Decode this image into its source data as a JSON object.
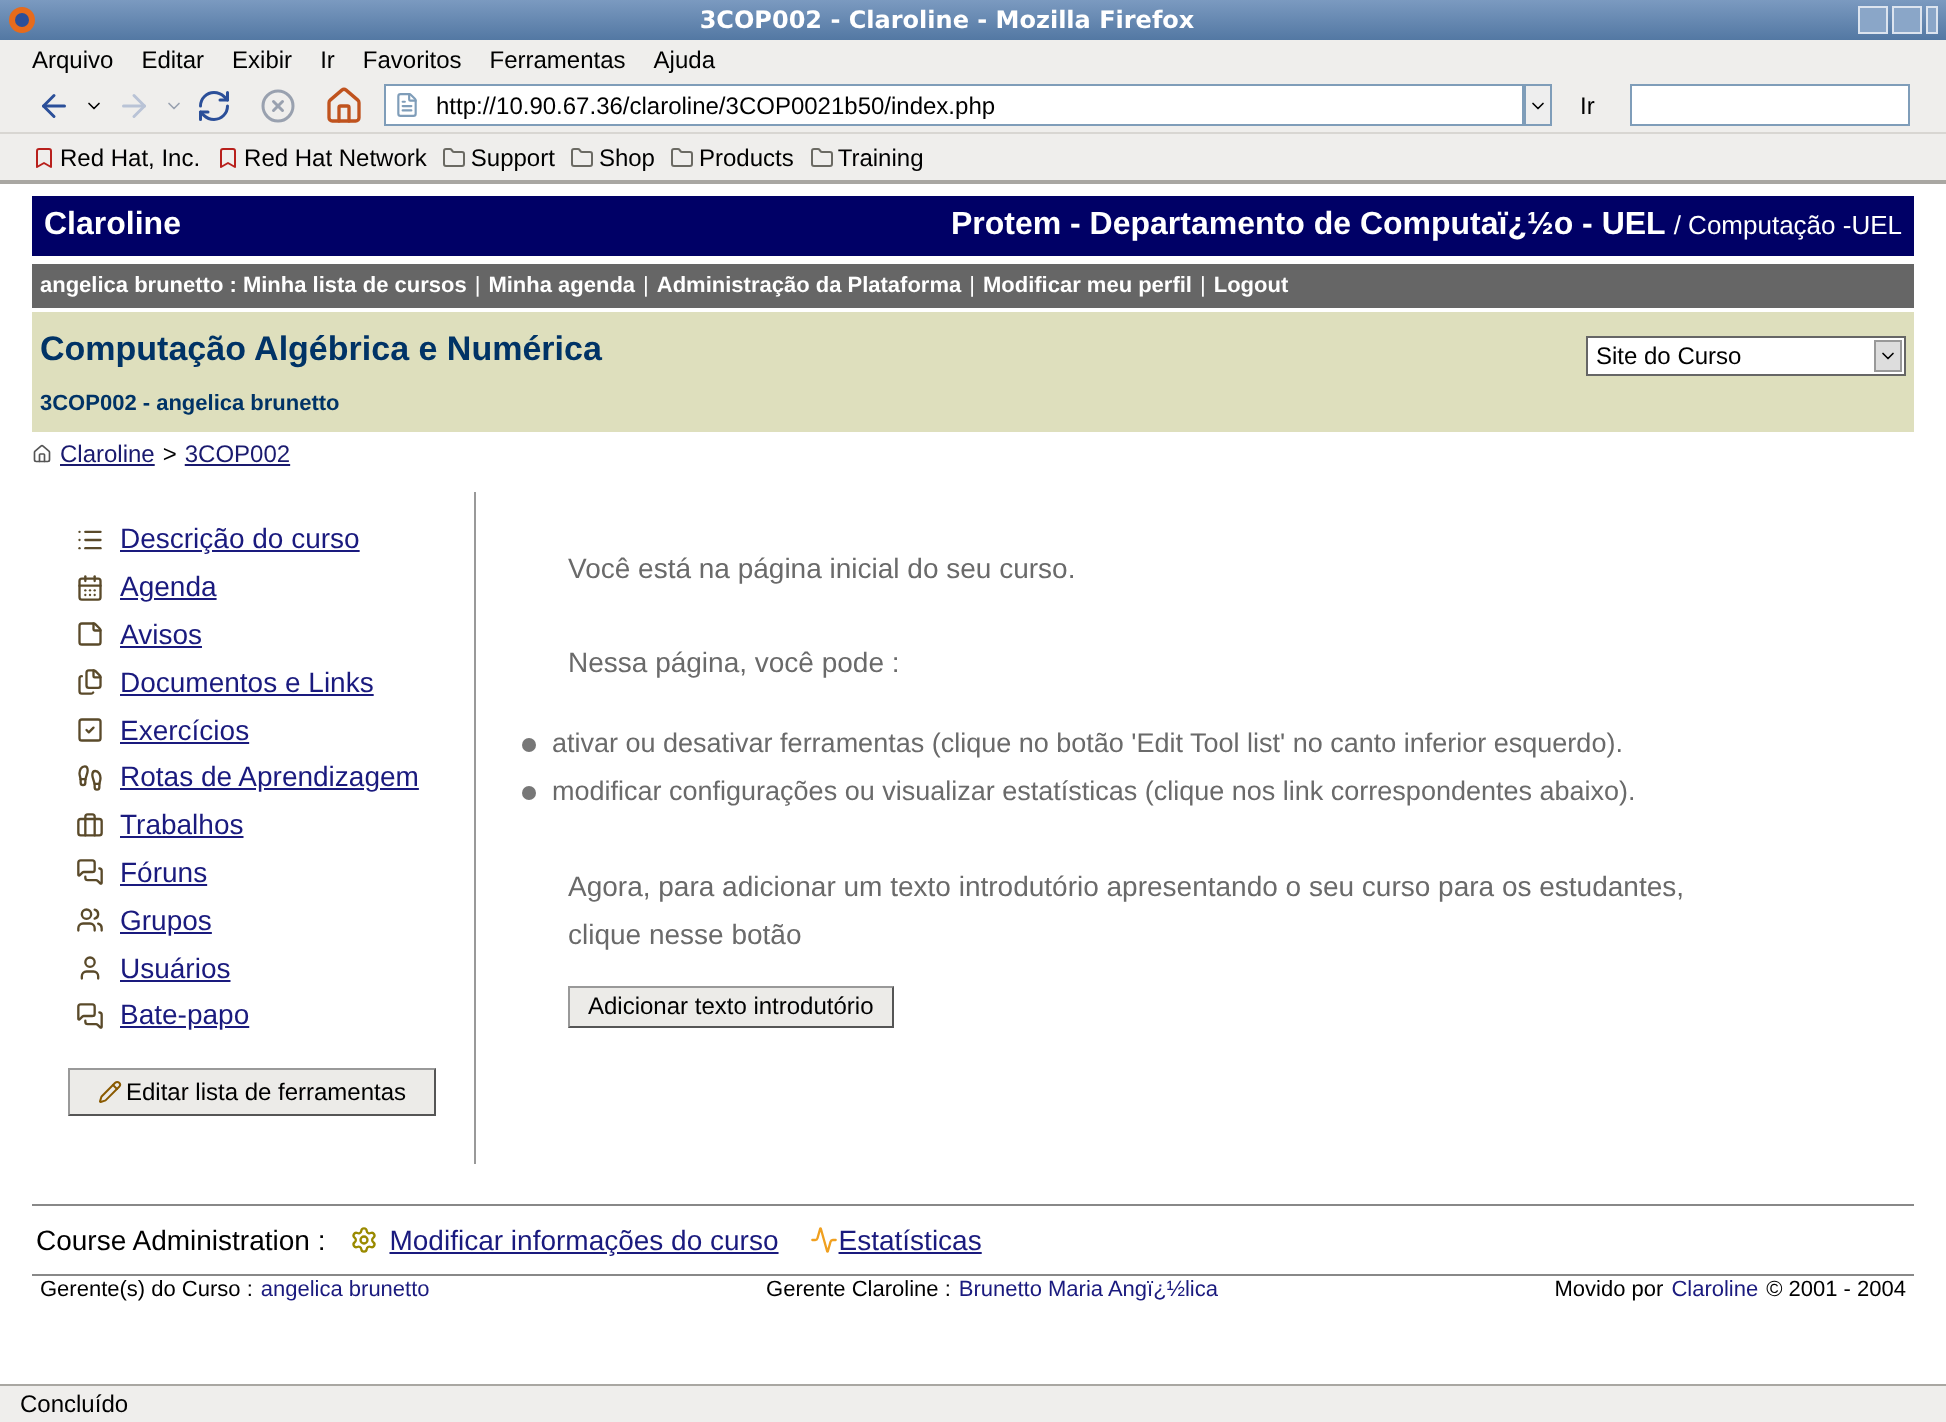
{
  "window": {
    "title": "3COP002 - Claroline - Mozilla Firefox"
  },
  "menu": [
    "Arquivo",
    "Editar",
    "Exibir",
    "Ir",
    "Favoritos",
    "Ferramentas",
    "Ajuda"
  ],
  "toolbar": {
    "url": "http://10.90.67.36/claroline/3COP0021b50/index.php",
    "go_label": "Ir"
  },
  "bookmarks": [
    {
      "label": "Red Hat, Inc.",
      "kind": "page"
    },
    {
      "label": "Red Hat Network",
      "kind": "page"
    },
    {
      "label": "Support",
      "kind": "folder"
    },
    {
      "label": "Shop",
      "kind": "folder"
    },
    {
      "label": "Products",
      "kind": "folder"
    },
    {
      "label": "Training",
      "kind": "folder"
    }
  ],
  "header": {
    "site": "Claroline",
    "institution": "Protem - Departamento de Computaï¿½o - UEL",
    "department": "/ Computação -UEL"
  },
  "user_bar_separator": "|",
  "breadcrumb_separator": ">",
  "user_bar": [
    "angelica brunetto : Minha lista de cursos",
    "Minha agenda",
    "Administração da Plataforma",
    "Modificar meu perfil",
    "Logout"
  ],
  "course": {
    "title": "Computação Algébrica e Numérica",
    "code": "3COP002 - angelica brunetto",
    "select_value": "Site do Curso"
  },
  "breadcrumb": [
    "Claroline",
    "3COP002"
  ],
  "tools": [
    {
      "label": "Descrição do curso",
      "kind": "list"
    },
    {
      "label": "Agenda",
      "kind": "calendar"
    },
    {
      "label": "Avisos",
      "kind": "notice"
    },
    {
      "label": "Documentos e Links",
      "kind": "documents"
    },
    {
      "label": "Exercícios",
      "kind": "check"
    },
    {
      "label": "Rotas de Aprendizagem",
      "kind": "path"
    },
    {
      "label": "Trabalhos",
      "kind": "work"
    },
    {
      "label": "Fóruns",
      "kind": "forum"
    },
    {
      "label": "Grupos",
      "kind": "group"
    },
    {
      "label": "Usuários",
      "kind": "user"
    },
    {
      "label": "Bate-papo",
      "kind": "forum"
    }
  ],
  "edit_tools_button": "Editar lista de ferramentas",
  "intro": {
    "line_1": "Você está na página inicial do seu curso.",
    "line_2": "Nessa página, você pode :",
    "bullets": [
      "ativar ou desativar ferramentas (clique no botão 'Edit Tool list' no canto inferior esquerdo).",
      "modificar configurações ou visualizar estatísticas (clique nos link correspondentes abaixo)."
    ],
    "line_3": "Agora, para adicionar um texto introdutório apresentando o seu curso para os estudantes, clique nesse botão",
    "button": "Adicionar texto introdutório"
  },
  "admin": {
    "label": "Course Administration :",
    "links": [
      "Modificar informações do curso",
      "Estatísticas"
    ]
  },
  "footer": {
    "managers_label": "Gerente(s) do Curso :",
    "managers": "angelica brunetto",
    "claroline_manager_label": "Gerente Claroline :",
    "claroline_manager": "Brunetto Maria Angï¿½lica",
    "powered_label": "Movido por",
    "powered": "Claroline",
    "copyright": "© 2001 - 2004"
  },
  "status_bar": "Concluído"
}
